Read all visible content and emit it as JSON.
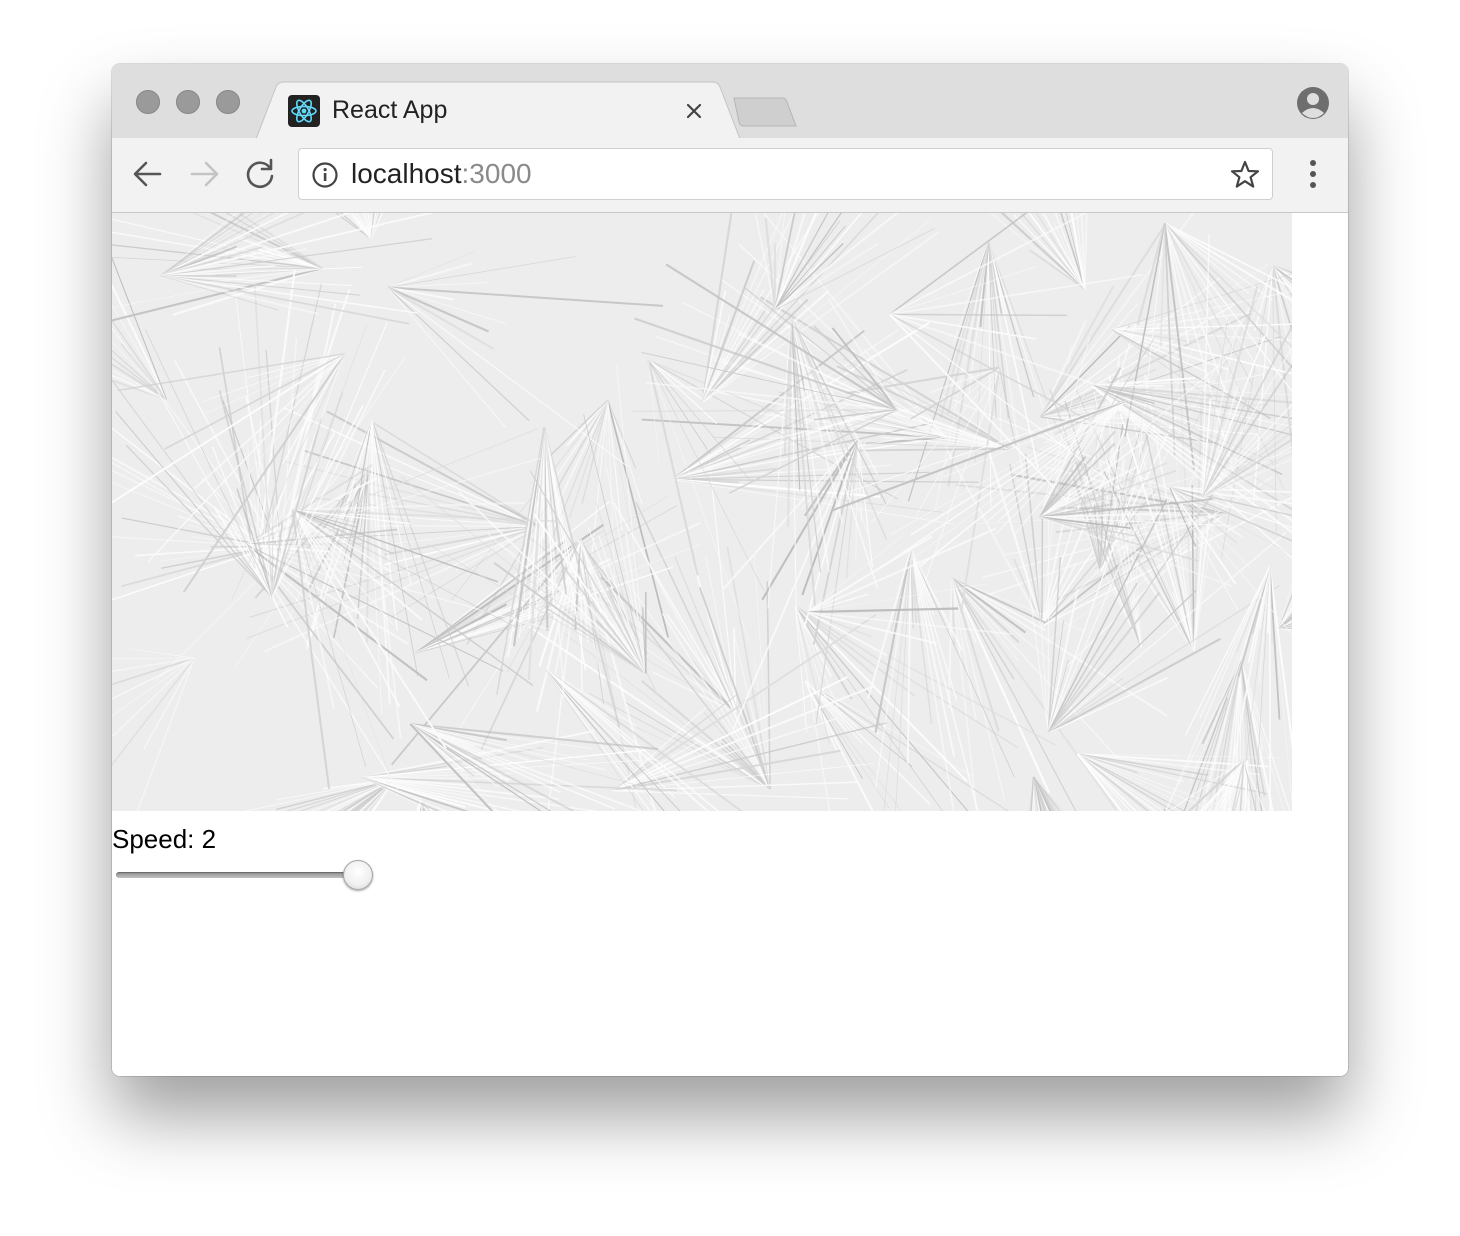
{
  "browser": {
    "tab": {
      "title": "React App",
      "favicon": "react-logo-icon"
    },
    "new_tab_icon": "new-tab-icon",
    "profile_icon": "profile-icon",
    "nav": {
      "back": "back-arrow-icon",
      "forward": "forward-arrow-icon",
      "reload": "reload-icon"
    },
    "address": {
      "host": "localhost",
      "port": ":3000",
      "info_icon": "info-icon",
      "bookmark_icon": "star-icon"
    },
    "menu_icon": "kebab-menu-icon"
  },
  "page": {
    "canvas_description_icon": "generative-art-canvas",
    "speed": {
      "label": "Speed: 2",
      "value": 2
    }
  },
  "colors": {
    "titlebar": "#dedede",
    "toolbar": "#f2f2f2",
    "traffic_light": "#9a9a9a",
    "react_cyan": "#61dafb",
    "canvas_bg": "#ededed"
  }
}
